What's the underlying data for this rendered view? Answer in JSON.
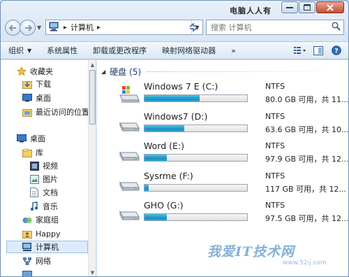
{
  "window": {
    "watermark_title": "电脑人人有"
  },
  "address": {
    "crumb": "计算机",
    "separator": "▸"
  },
  "search": {
    "placeholder": "搜索 计算机"
  },
  "toolbar": {
    "items": [
      "组织",
      "系统属性",
      "卸载或更改程序",
      "映射网络驱动器"
    ],
    "overflow": "»"
  },
  "nav": {
    "items": [
      {
        "label": "收藏夹",
        "icon": "star-icon"
      },
      {
        "label": "下载",
        "icon": "download-folder-icon"
      },
      {
        "label": "桌面",
        "icon": "desktop-icon"
      },
      {
        "label": "最近访问的位置",
        "icon": "recent-places-icon"
      },
      {
        "label": "桌面",
        "icon": "desktop-icon"
      },
      {
        "label": "库",
        "icon": "libraries-icon"
      },
      {
        "label": "视频",
        "icon": "video-library-icon"
      },
      {
        "label": "图片",
        "icon": "pictures-library-icon"
      },
      {
        "label": "文档",
        "icon": "documents-library-icon"
      },
      {
        "label": "音乐",
        "icon": "music-library-icon"
      },
      {
        "label": "家庭组",
        "icon": "homegroup-icon"
      },
      {
        "label": "Happy",
        "icon": "user-folder-icon"
      },
      {
        "label": "计算机",
        "icon": "computer-icon"
      },
      {
        "label": "网络",
        "icon": "network-icon"
      }
    ]
  },
  "content": {
    "group_title": "硬盘",
    "group_count": "(5)",
    "drives": [
      {
        "name": "Windows 7 E (C:)",
        "fs": "NTFS",
        "space": "80.0 GB 可用，共 11...",
        "used_fraction": 0.54,
        "icon": "system-drive-icon"
      },
      {
        "name": "Windows7 (D:)",
        "fs": "NTFS",
        "space": "63.6 GB 可用，共 10...",
        "used_fraction": 0.39,
        "icon": "hard-drive-icon"
      },
      {
        "name": "Word (E:)",
        "fs": "NTFS",
        "space": "97.9 GB 可用，共 12...",
        "used_fraction": 0.22,
        "icon": "hard-drive-icon"
      },
      {
        "name": "Sysrme (F:)",
        "fs": "NTFS",
        "space": "117 GB 可用，共 12...",
        "used_fraction": 0.04,
        "icon": "hard-drive-icon"
      },
      {
        "name": "GHO (G:)",
        "fs": "NTFS",
        "space": "97.5 GB 可用，共 12...",
        "used_fraction": 0.22,
        "icon": "hard-drive-icon"
      }
    ]
  },
  "watermark": {
    "logo": "我爱IT技术网",
    "url": "www.52ij.com"
  },
  "colors": {
    "bar_fill": "#1b90c4",
    "selected_bg": "#dcebfc",
    "group_title": "#1e3a6e"
  }
}
